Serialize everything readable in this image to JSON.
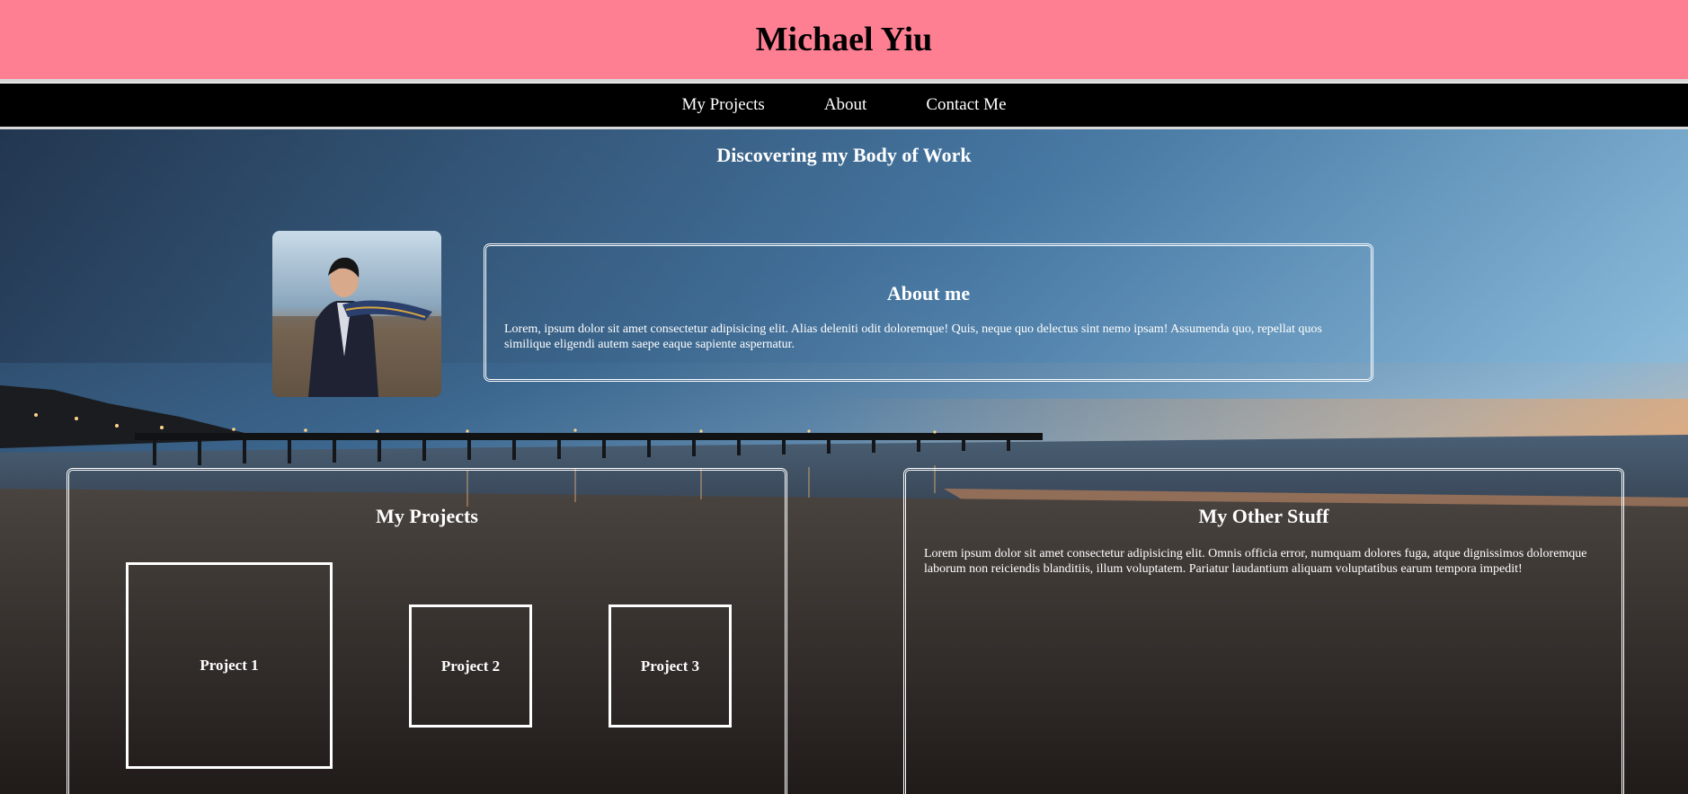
{
  "site": {
    "title": "Michael Yiu"
  },
  "nav": {
    "items": [
      "My Projects",
      "About",
      "Contact Me"
    ]
  },
  "main": {
    "heading": "Discovering my Body of Work"
  },
  "about": {
    "title": "About me",
    "body": "Lorem, ipsum dolor sit amet consectetur adipisicing elit. Alias deleniti odit doloremque! Quis, neque quo delectus sint nemo ipsam! Assumenda quo, repellat quos similique eligendi autem saepe eaque sapiente aspernatur."
  },
  "projects": {
    "title": "My Projects",
    "items": [
      "Project 1",
      "Project 2",
      "Project 3"
    ]
  },
  "other": {
    "title": "My Other Stuff",
    "body": "Lorem ipsum dolor sit amet consectetur adipisicing elit. Omnis officia error, numquam dolores fuga, atque dignissimos doloremque laborum non reiciendis blanditiis, illum voluptatem. Pariatur laudantium aliquam voluptatibus earum tempora impedit!"
  },
  "colors": {
    "header": "#ff7f92",
    "nav": "#000000",
    "text_light": "#ffffff"
  }
}
